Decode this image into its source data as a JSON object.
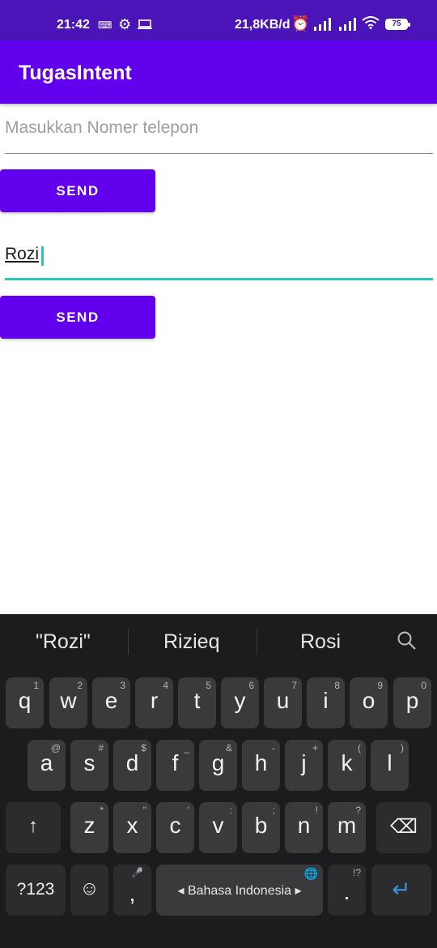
{
  "status_bar": {
    "time": "21:42",
    "keyboard_indicator": "⌨",
    "network_speed": "21,8KB/d",
    "battery": "75",
    "icons": [
      "keyboard-icon",
      "gear-icon",
      "laptop-icon",
      "alarm-icon",
      "signal-icon",
      "signal-icon",
      "wifi-icon",
      "battery-icon"
    ]
  },
  "app_bar": {
    "title": "TugasIntent"
  },
  "form": {
    "phone_placeholder": "Masukkan Nomer telepon",
    "send_label_1": "SEND",
    "name_value": "Rozi",
    "send_label_2": "SEND"
  },
  "keyboard": {
    "suggestions": [
      "\"Rozi\"",
      "Rizieq",
      "Rosi"
    ],
    "row1": [
      {
        "key": "q",
        "hint": "1"
      },
      {
        "key": "w",
        "hint": "2"
      },
      {
        "key": "e",
        "hint": "3"
      },
      {
        "key": "r",
        "hint": "4"
      },
      {
        "key": "t",
        "hint": "5"
      },
      {
        "key": "y",
        "hint": "6"
      },
      {
        "key": "u",
        "hint": "7"
      },
      {
        "key": "i",
        "hint": "8"
      },
      {
        "key": "o",
        "hint": "9"
      },
      {
        "key": "p",
        "hint": "0"
      }
    ],
    "row2": [
      {
        "key": "a",
        "hint": "@"
      },
      {
        "key": "s",
        "hint": "#"
      },
      {
        "key": "d",
        "hint": "$"
      },
      {
        "key": "f",
        "hint": "_"
      },
      {
        "key": "g",
        "hint": "&"
      },
      {
        "key": "h",
        "hint": "-"
      },
      {
        "key": "j",
        "hint": "+"
      },
      {
        "key": "k",
        "hint": "("
      },
      {
        "key": "l",
        "hint": ")"
      }
    ],
    "row3": [
      {
        "key": "z",
        "hint": "*"
      },
      {
        "key": "x",
        "hint": "\""
      },
      {
        "key": "c",
        "hint": "'"
      },
      {
        "key": "v",
        "hint": ":"
      },
      {
        "key": "b",
        "hint": ";"
      },
      {
        "key": "n",
        "hint": "!"
      },
      {
        "key": "m",
        "hint": "?"
      }
    ],
    "shift_icon": "↑",
    "backspace_icon": "⌫",
    "symbols_label": "?123",
    "emoji_icon": "☺",
    "comma": ",",
    "comma_hint": "🎤",
    "space_label": "Bahasa Indonesia",
    "space_hint": "🌐",
    "period": ".",
    "period_hint": "!?",
    "enter_icon": "↵",
    "accent_color": "#6200ee",
    "focus_color": "#26c6b8"
  }
}
